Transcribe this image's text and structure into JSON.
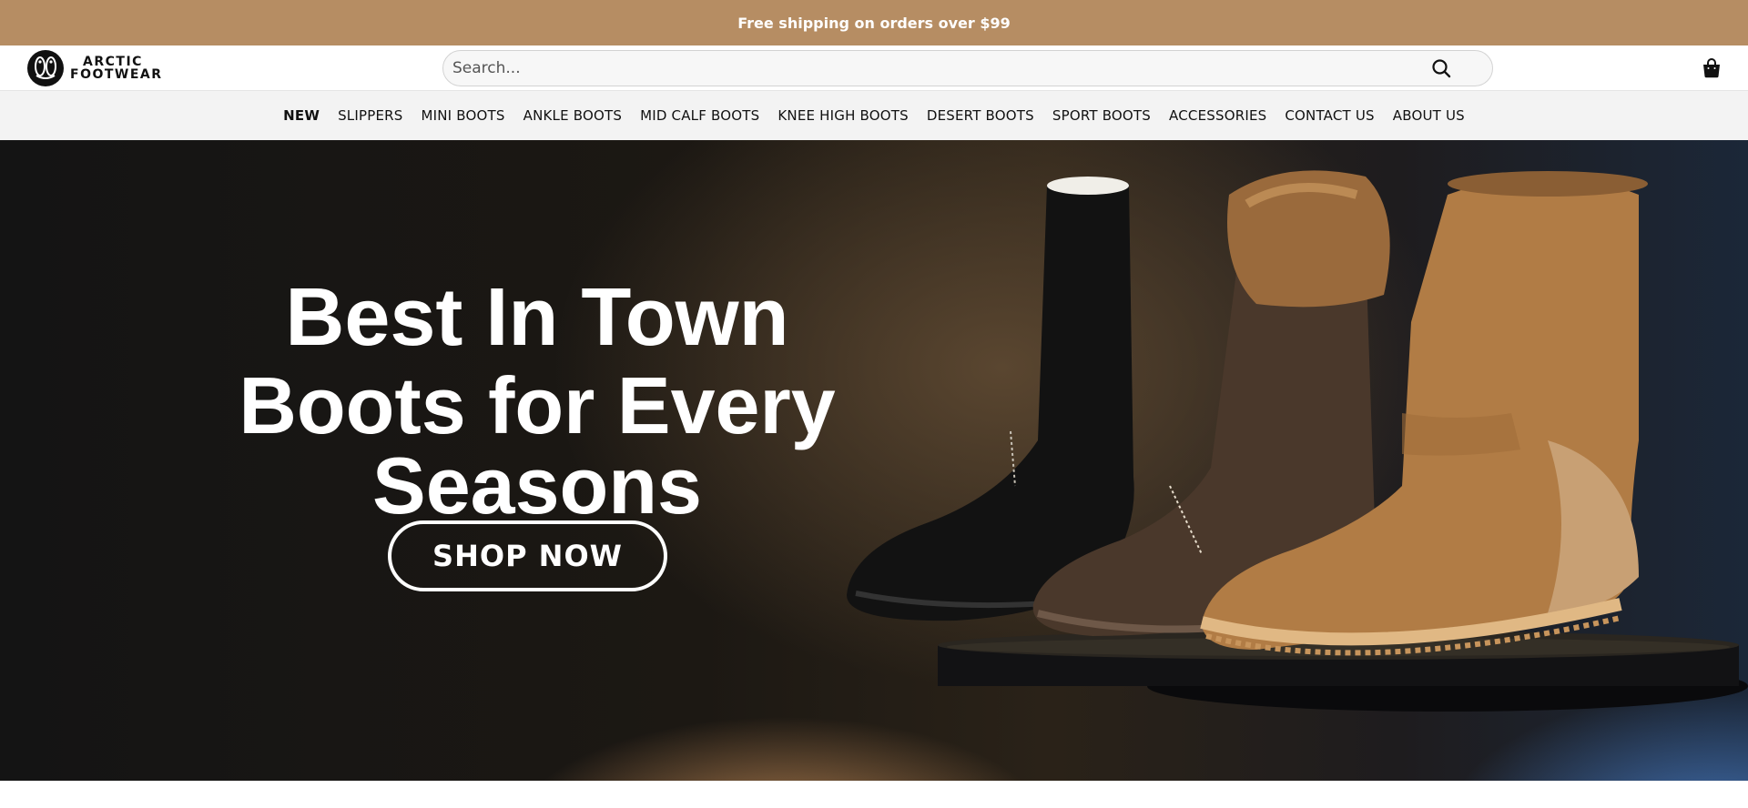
{
  "announcement": {
    "text": "Free shipping on orders over $99"
  },
  "header": {
    "logo_line1": "ARCTIC",
    "logo_line2": "FOOTWEAR",
    "search_placeholder": "Search...",
    "icons": {
      "search": "search-icon",
      "cart": "shopping-bag-icon"
    }
  },
  "nav": {
    "items": [
      {
        "label": "NEW",
        "active": true
      },
      {
        "label": "SLIPPERS"
      },
      {
        "label": "MINI BOOTS"
      },
      {
        "label": "ANKLE BOOTS"
      },
      {
        "label": "MID CALF BOOTS"
      },
      {
        "label": "KNEE HIGH BOOTS"
      },
      {
        "label": "DESERT BOOTS"
      },
      {
        "label": "SPORT BOOTS"
      },
      {
        "label": "ACCESSORIES"
      },
      {
        "label": "CONTACT US"
      },
      {
        "label": "ABOUT US"
      }
    ]
  },
  "hero": {
    "title_line1": "Best In Town",
    "title_line2": "Boots for Every Seasons",
    "cta_label": "SHOP NOW"
  },
  "colors": {
    "announcement_bg": "#b68d63",
    "nav_bg": "#f3f3f3",
    "hero_text": "#ffffff"
  }
}
